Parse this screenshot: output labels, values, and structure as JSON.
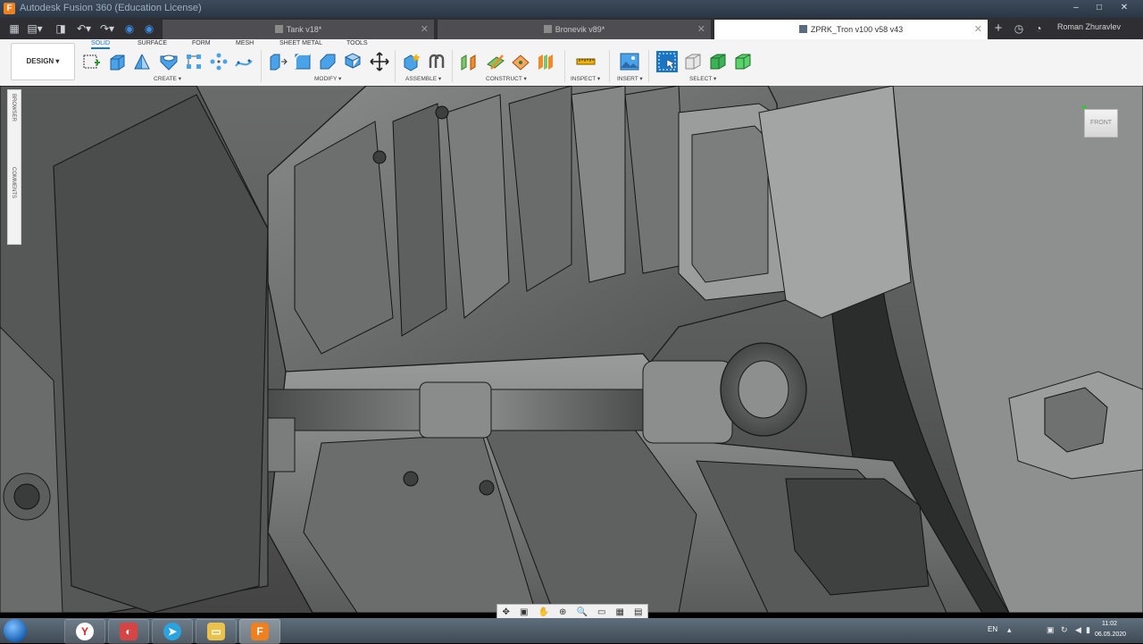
{
  "window": {
    "title": "Autodesk Fusion 360 (Education License)",
    "controls": [
      "–",
      "□",
      "✕"
    ]
  },
  "tabs": [
    {
      "label": "Tank v18*",
      "active": false
    },
    {
      "label": "Bronevik v89*",
      "active": false
    },
    {
      "label": "ZPRK_Tron v100 v58 v43",
      "active": true
    }
  ],
  "user": {
    "name": "Roman Zhuravlev"
  },
  "workspace": {
    "label": "DESIGN ▾"
  },
  "ribbon_tabs": [
    "SOLID",
    "SURFACE",
    "FORM",
    "MESH",
    "SHEET METAL",
    "TOOLS"
  ],
  "ribbon_groups": [
    "CREATE ▾",
    "MODIFY ▾",
    "ASSEMBLE ▾",
    "CONSTRUCT ▾",
    "INSPECT ▾",
    "INSERT ▾",
    "SELECT ▾"
  ],
  "side_panel": {
    "browser": "BROWSER",
    "comments": "COMMENTS"
  },
  "viewcube": {
    "face": "FRONT"
  },
  "taskbar": {
    "language": "EN",
    "time": "11:02",
    "date": "06.05.2020"
  },
  "colors": {
    "accent": "#1a76c2",
    "fusion_orange": "#f07f1e"
  }
}
